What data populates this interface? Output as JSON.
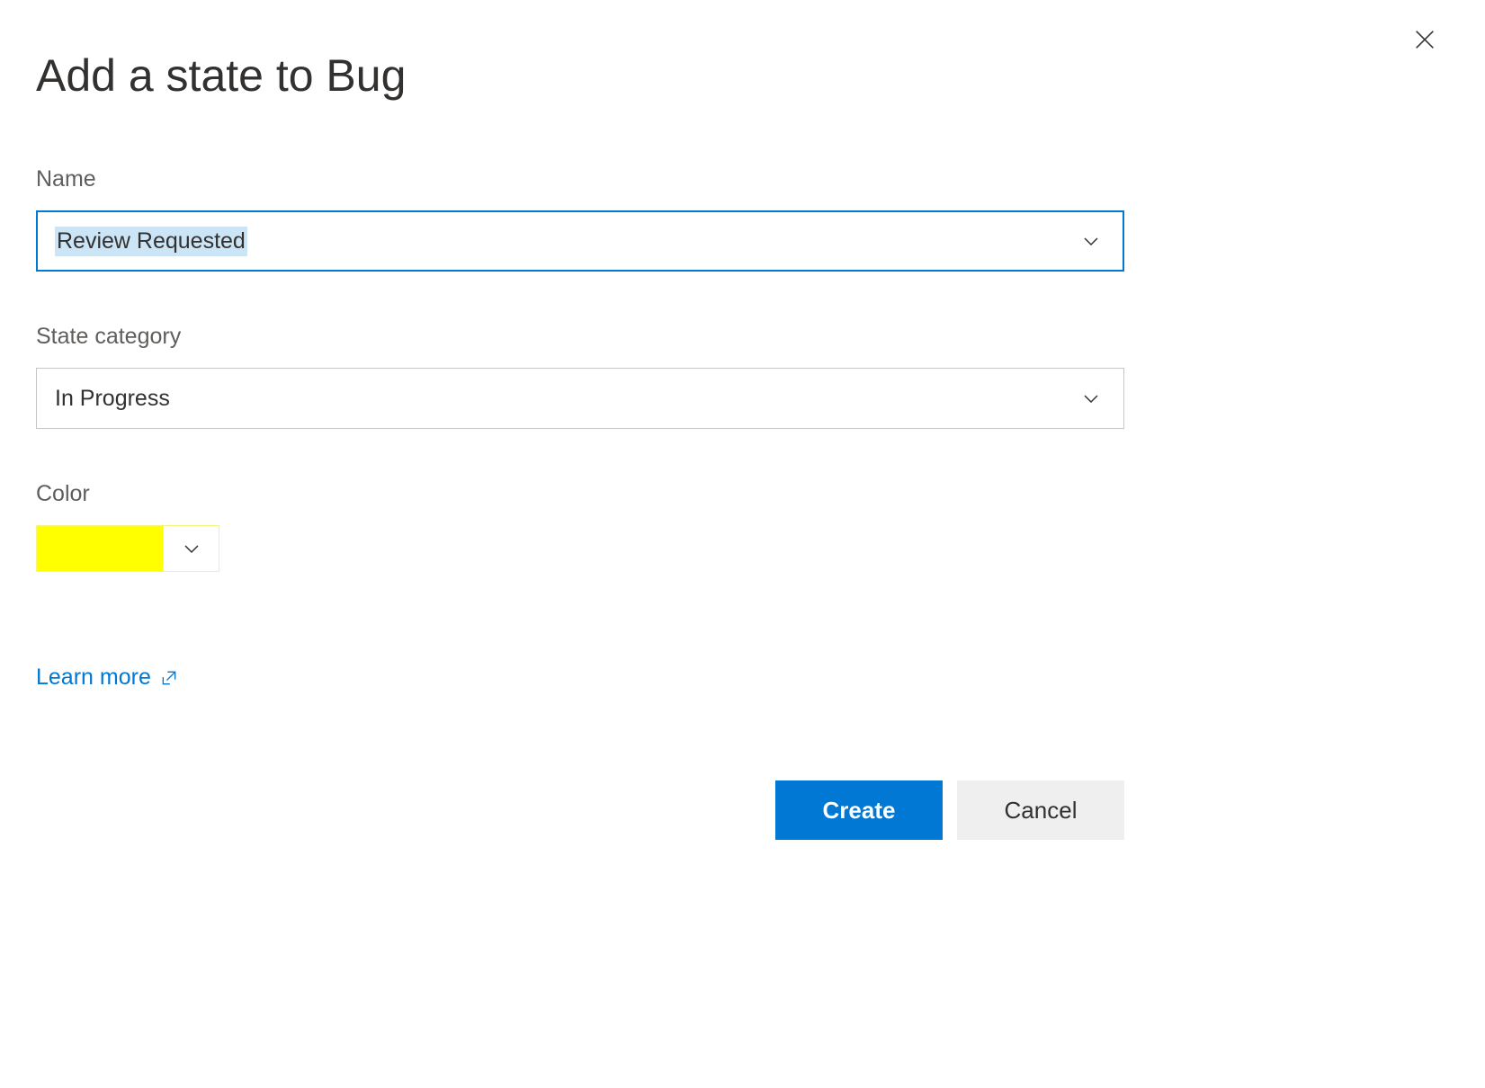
{
  "dialog": {
    "title": "Add a state to Bug"
  },
  "fields": {
    "name": {
      "label": "Name",
      "value": "Review Requested"
    },
    "category": {
      "label": "State category",
      "value": "In Progress"
    },
    "color": {
      "label": "Color",
      "swatch_hex": "#ffff00"
    }
  },
  "links": {
    "learn_more": "Learn more"
  },
  "buttons": {
    "create": "Create",
    "cancel": "Cancel"
  }
}
